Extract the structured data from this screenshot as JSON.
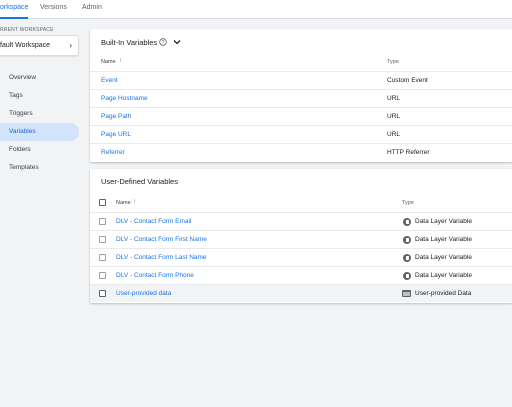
{
  "tabs": [
    {
      "label": "orkspace"
    },
    {
      "label": "Versions"
    },
    {
      "label": "Admin"
    }
  ],
  "sidebar": {
    "workspace_label": "RRENT WORKSPACE",
    "workspace_name": "fault Workspace",
    "items": [
      {
        "label": "Overview"
      },
      {
        "label": "Tags"
      },
      {
        "label": "Triggers"
      },
      {
        "label": "Variables"
      },
      {
        "label": "Folders"
      },
      {
        "label": "Templates"
      }
    ]
  },
  "builtin": {
    "title": "Built-In Variables",
    "col_name": "Name",
    "col_type": "Type",
    "rows": [
      {
        "name": "Event",
        "type": "Custom Event"
      },
      {
        "name": "Page Hostname",
        "type": "URL"
      },
      {
        "name": "Page Path",
        "type": "URL"
      },
      {
        "name": "Page URL",
        "type": "URL"
      },
      {
        "name": "Referrer",
        "type": "HTTP Referrer"
      }
    ]
  },
  "userdefined": {
    "title": "User-Defined Variables",
    "col_name": "Name",
    "col_type": "Type",
    "rows": [
      {
        "name": "DLV - Contact Form Email",
        "type": "Data Layer Variable"
      },
      {
        "name": "DLV - Contact Form First Name",
        "type": "Data Layer Variable"
      },
      {
        "name": "DLV - Contact Form Last Name",
        "type": "Data Layer Variable"
      },
      {
        "name": "DLV - Contact Form Phone",
        "type": "Data Layer Variable"
      },
      {
        "name": "User-provided data",
        "type": "User-provided Data"
      }
    ]
  },
  "icons": {
    "help": "help-circle-icon",
    "chevron_down": "chevron-down-icon",
    "chevron_right": "chevron-right-icon",
    "sort": "sort-arrow-up-icon",
    "variable_type": "data-layer-variable-icon",
    "user_data_type": "folder-icon"
  },
  "colors": {
    "accent": "#1a73e8",
    "active_nav_bg": "#d2e3fc",
    "background": "#f1f3f4"
  }
}
